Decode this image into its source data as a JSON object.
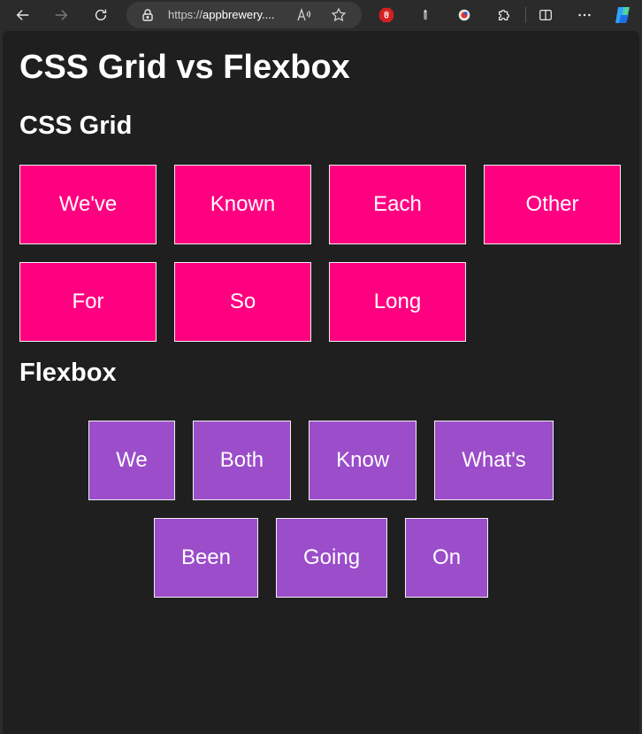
{
  "browser": {
    "url_prefix": "https://",
    "url_host": "appbrewery....",
    "read_aloud_label": "A",
    "read_aloud_sup": "))"
  },
  "page": {
    "title": "CSS Grid vs Flexbox",
    "grid_heading": "CSS Grid",
    "flex_heading": "Flexbox",
    "grid_items": [
      "We've",
      "Known",
      "Each",
      "Other",
      "For",
      "So",
      "Long"
    ],
    "flex_items": [
      "We",
      "Both",
      "Know",
      "What's",
      "Been",
      "Going",
      "On"
    ]
  },
  "colors": {
    "grid_box": "#ff0080",
    "flex_box": "#9b4dca",
    "page_bg": "#1f1f1f",
    "toolbar_bg": "#2b2b2b"
  }
}
